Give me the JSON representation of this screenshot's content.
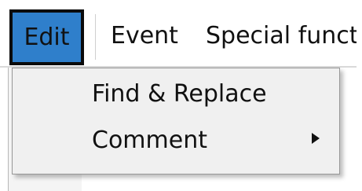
{
  "menu_bar": {
    "items": [
      {
        "label": "Edit",
        "state": "selected"
      },
      {
        "label": "Event"
      },
      {
        "label": "Special functio"
      }
    ]
  },
  "dropdown": {
    "items": [
      {
        "label": "Find & Replace",
        "has_submenu": false
      },
      {
        "label": "Comment",
        "has_submenu": true,
        "submenu_icon": "submenu-arrow-icon"
      }
    ]
  },
  "colors": {
    "selected_menu_bg": "#2f7fcb",
    "selected_menu_border": "#0b0b0b",
    "dropdown_bg": "#f0f0f0",
    "dropdown_border": "#979797",
    "menubar_separator": "#d9d9d9",
    "text": "#111111"
  }
}
